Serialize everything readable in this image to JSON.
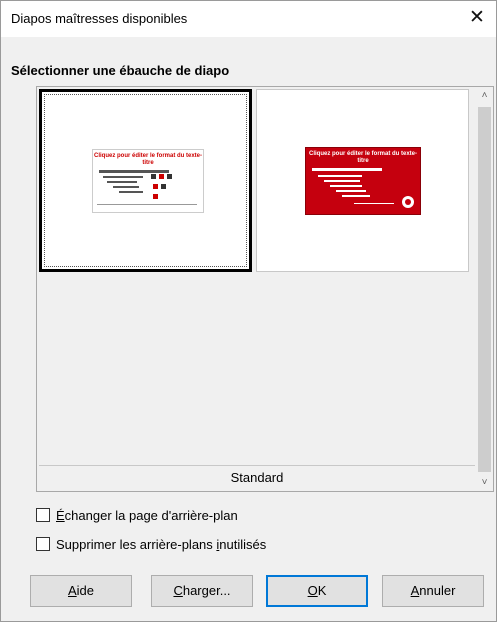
{
  "window": {
    "title": "Diapos maîtresses disponibles",
    "close_glyph": "✕"
  },
  "section": {
    "heading": "Sélectionner une ébauche de diapo"
  },
  "templates": [
    {
      "name": "white-template",
      "selected": true,
      "preview_title": "Cliquez pour éditer le format du texte-titre",
      "accent": "#c00000"
    },
    {
      "name": "red-template",
      "selected": false,
      "preview_title": "Cliquez pour éditer le format du texte-titre",
      "accent": "#c5000e"
    }
  ],
  "group": {
    "label": "Standard"
  },
  "scrollbar": {
    "up_glyph": "˄",
    "down_glyph": "˅"
  },
  "options": {
    "exchange_bg": {
      "pre": "",
      "accel": "É",
      "post": "changer la page d'arrière-plan",
      "checked": false
    },
    "delete_unused": {
      "pre": "Supprimer les arrière-plans ",
      "accel": "i",
      "post": "nutilisés",
      "checked": false
    }
  },
  "buttons": {
    "help": {
      "pre": "",
      "accel": "A",
      "post": "ide"
    },
    "load": {
      "pre": "",
      "accel": "C",
      "post": "harger..."
    },
    "ok": {
      "pre": "",
      "accel": "O",
      "post": "K"
    },
    "cancel": {
      "pre": "",
      "accel": "A",
      "post": "nnuler"
    }
  }
}
